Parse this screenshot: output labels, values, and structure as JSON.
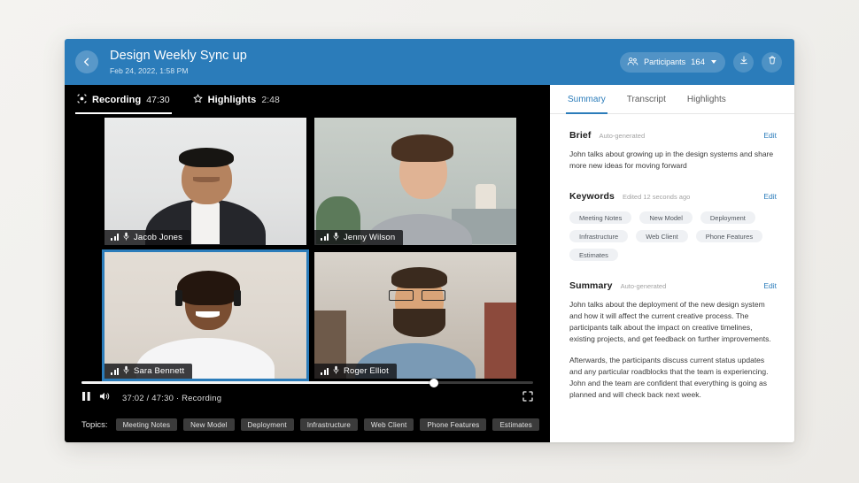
{
  "header": {
    "back_icon": "chevron-left-icon",
    "title": "Design Weekly Sync up",
    "datetime": "Feb 24, 2022, 1:58 PM",
    "participants_label": "Participants",
    "participants_count": "164",
    "participants_icon": "people-icon",
    "download_icon": "download-icon",
    "delete_icon": "trash-icon",
    "accent": "#2b7cba"
  },
  "player": {
    "tabs": [
      {
        "label": "Recording",
        "time": "47:30",
        "icon": "record-icon",
        "active": true
      },
      {
        "label": "Highlights",
        "time": "2:48",
        "icon": "star-icon",
        "active": false
      }
    ],
    "tiles": [
      {
        "name": "Jacob Jones",
        "signal_icon": "signal-bars-icon",
        "mic_icon": "microphone-icon",
        "selected": false
      },
      {
        "name": "Jenny Wilson",
        "signal_icon": "signal-bars-icon",
        "mic_icon": "microphone-icon",
        "selected": false
      },
      {
        "name": "Sara Bennett",
        "signal_icon": "signal-bars-icon",
        "mic_icon": "microphone-icon",
        "selected": true
      },
      {
        "name": "Roger Elliot",
        "signal_icon": "signal-bars-icon",
        "mic_icon": "microphone-icon",
        "selected": false
      }
    ],
    "controls": {
      "play_icon": "pause-icon",
      "volume_icon": "volume-icon",
      "fullscreen_icon": "fullscreen-icon",
      "time_status": "37:02 / 47:30  ·  Recording",
      "progress_percent": 78
    },
    "topics_label": "Topics:",
    "topics": [
      "Meeting Notes",
      "New Model",
      "Deployment",
      "Infrastructure",
      "Web Client",
      "Phone Features",
      "Estimates"
    ]
  },
  "panel": {
    "tabs": [
      {
        "label": "Summary",
        "active": true
      },
      {
        "label": "Transcript",
        "active": false
      },
      {
        "label": "Highlights",
        "active": false
      }
    ],
    "brief": {
      "title": "Brief",
      "meta": "Auto-generated",
      "edit": "Edit",
      "text": "John talks about growing up in the design systems and share more new ideas for moving forward"
    },
    "keywords": {
      "title": "Keywords",
      "meta": "Edited 12 seconds ago",
      "edit": "Edit",
      "items": [
        "Meeting Notes",
        "New Model",
        "Deployment",
        "Infrastructure",
        "Web Client",
        "Phone Features",
        "Estimates"
      ]
    },
    "summary": {
      "title": "Summary",
      "meta": "Auto-generated",
      "edit": "Edit",
      "paragraph1": "John talks about the deployment of the new design system and how it will affect the current creative process. The participants talk about the impact on creative timelines, existing projects, and get feedback on further improvements.",
      "paragraph2": "Afterwards, the participants discuss current status updates and any particular roadblocks that the team is experiencing. John and the team are confident that everything is going as planned and will check back next week."
    }
  }
}
